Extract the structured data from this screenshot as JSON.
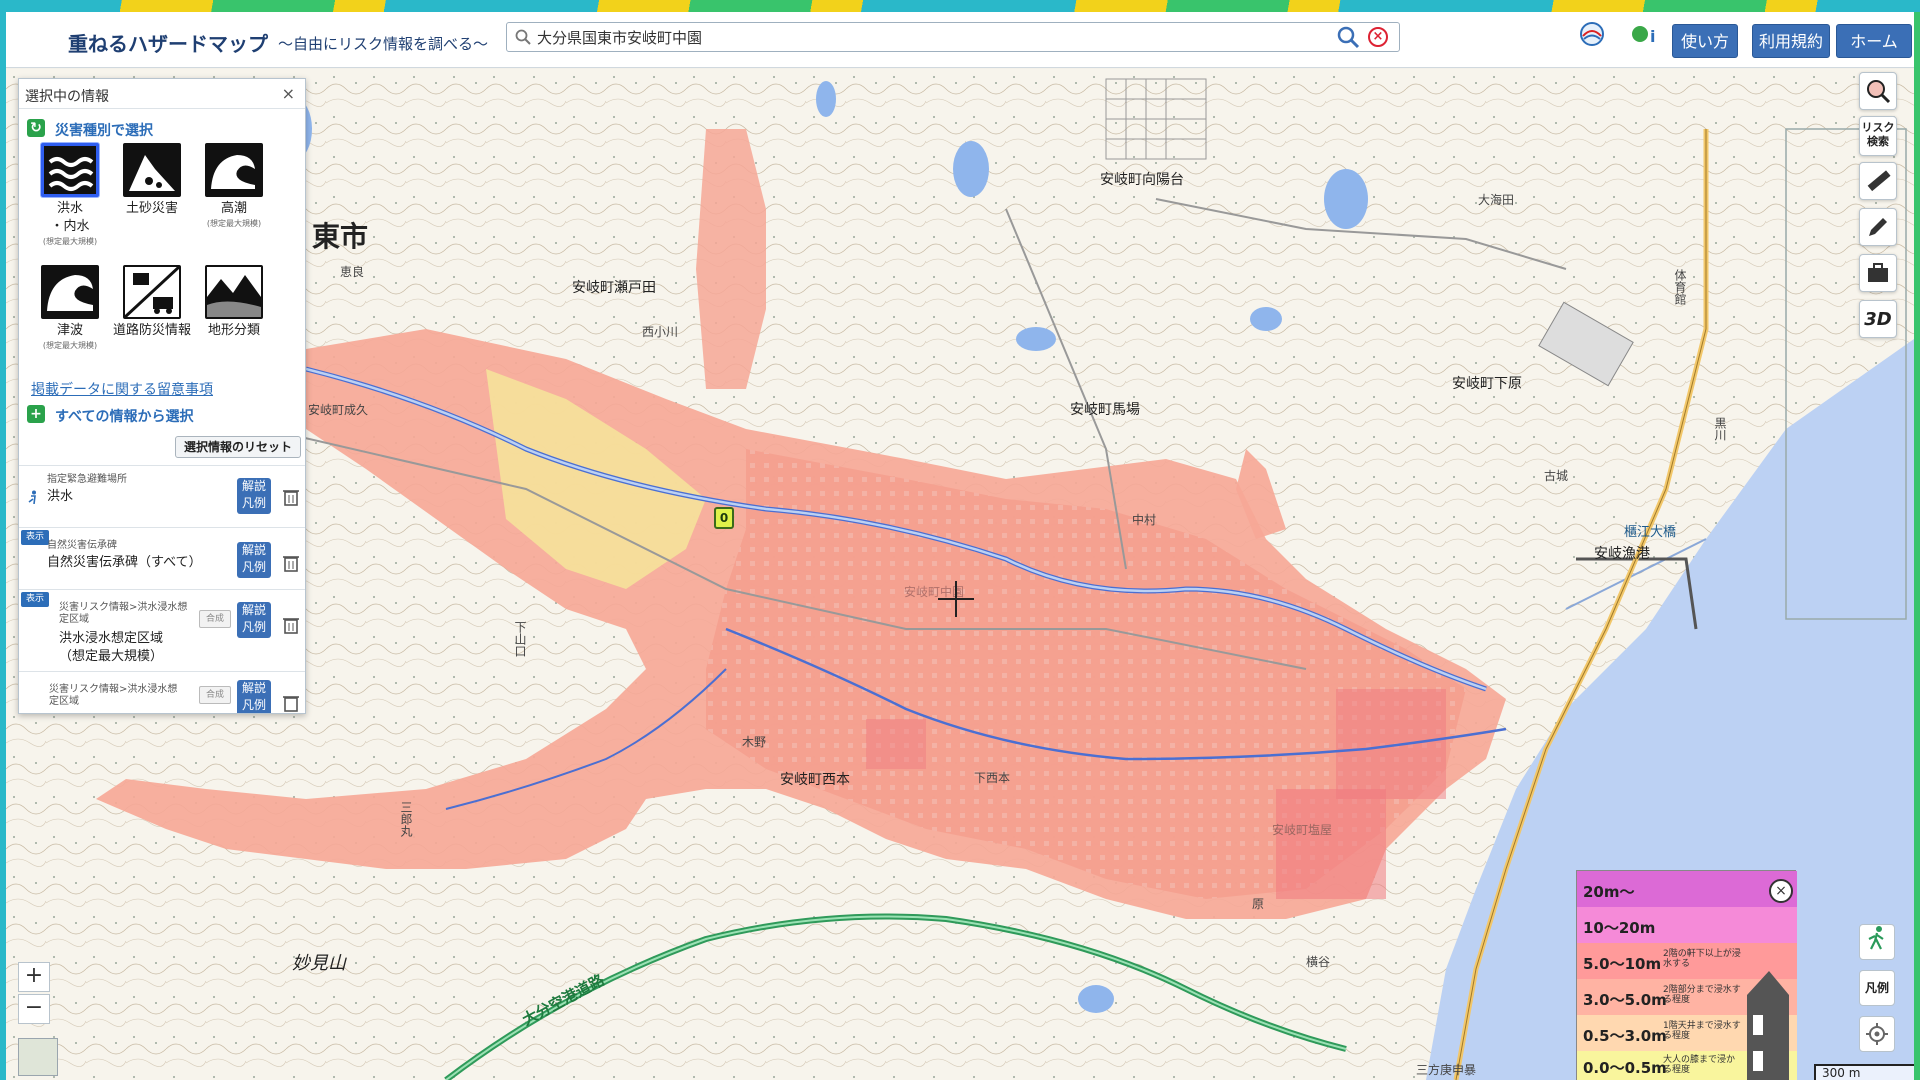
{
  "header": {
    "title": "重ねるハザードマップ",
    "subtitle": "〜自由にリスク情報を調べる〜",
    "search_value": "大分県国東市安岐町中園",
    "buttons": {
      "howto": "使い方",
      "terms": "利用規約",
      "home": "ホーム"
    },
    "logo1": "国土交通省",
    "logo2": "国土地理院"
  },
  "panel": {
    "title": "選択中の情報",
    "close": "×",
    "section1": "災害種別で選択",
    "hazards": [
      {
        "label": "洪水",
        "label2": "・内水",
        "note": "(想定最大規模)",
        "icon": "flood-icon",
        "selected": true
      },
      {
        "label": "土砂災害",
        "label2": "",
        "note": "",
        "icon": "landslide-icon",
        "selected": false
      },
      {
        "label": "高潮",
        "label2": "",
        "note": "(想定最大規模)",
        "icon": "storm-surge-icon",
        "selected": false
      },
      {
        "label": "津波",
        "label2": "",
        "note": "(想定最大規模)",
        "icon": "tsunami-icon",
        "selected": false
      },
      {
        "label": "道路防災情報",
        "label2": "",
        "note": "",
        "icon": "road-icon",
        "selected": false
      },
      {
        "label": "地形分類",
        "label2": "",
        "note": "",
        "icon": "terrain-icon",
        "selected": false
      }
    ],
    "notes_link": "掲載データに関する留意事項",
    "section2": "すべての情報から選択",
    "reset": "選択情報のリセット",
    "layers": [
      {
        "tag": "",
        "cat": "指定緊急避難場所",
        "name": "洪水",
        "legend": "解説\n凡例"
      },
      {
        "tag": "表示",
        "cat": "自然災害伝承碑",
        "name": "自然災害伝承碑（すべて）",
        "legend": "解説\n凡例"
      },
      {
        "tag": "表示",
        "cat": "災害リスク情報>洪水浸水想定区域",
        "name": "洪水浸水想定区域",
        "name2": "（想定最大規模）",
        "legend": "解説\n凡例",
        "merge": "合成"
      },
      {
        "tag": "",
        "cat": "災害リスク情報>洪水浸水想定区域",
        "name": "",
        "legend": "解説\n凡例",
        "merge": "合成"
      }
    ]
  },
  "map": {
    "places": [
      {
        "text": "東市",
        "cls": "big"
      },
      {
        "text": "安岐町向陽台",
        "cls": ""
      },
      {
        "text": "安岐町瀬戸田",
        "cls": ""
      },
      {
        "text": "西小川",
        "cls": "small"
      },
      {
        "text": "安岐町馬場",
        "cls": ""
      },
      {
        "text": "安岐町下原",
        "cls": ""
      },
      {
        "text": "大海田",
        "cls": "small"
      },
      {
        "text": "安岐町中園",
        "cls": "small"
      },
      {
        "text": "安岐町西本",
        "cls": ""
      },
      {
        "text": "下西本",
        "cls": "small"
      },
      {
        "text": "安岐町塩屋",
        "cls": "small"
      },
      {
        "text": "妙見山",
        "cls": "mountain"
      },
      {
        "text": "大分空港道路",
        "cls": "road"
      },
      {
        "text": "安岐漁港",
        "cls": ""
      },
      {
        "text": "櫃江大橋",
        "cls": "bridge"
      },
      {
        "text": "三方庚申暴",
        "cls": "small"
      },
      {
        "text": "中村",
        "cls": "small"
      },
      {
        "text": "古城",
        "cls": "small"
      },
      {
        "text": "木野",
        "cls": "small"
      },
      {
        "text": "下山口",
        "cls": "small"
      },
      {
        "text": "三郎丸",
        "cls": "small"
      },
      {
        "text": "横谷",
        "cls": "small"
      },
      {
        "text": "原",
        "cls": "small"
      },
      {
        "text": "恵良",
        "cls": "small"
      },
      {
        "text": "安岐町成久",
        "cls": "small"
      },
      {
        "text": "黒川",
        "cls": "small"
      },
      {
        "text": "体育館",
        "cls": "small"
      }
    ],
    "marker": "0",
    "scale": "300 m"
  },
  "toolbar": {
    "risk_search": "リスク検索",
    "three_d": "3D",
    "legend": "凡例"
  },
  "zoom": {
    "in": "+",
    "out": "−"
  },
  "legend": {
    "rows": [
      {
        "range": "20m〜",
        "desc": "",
        "color": "#dc6ad6"
      },
      {
        "range": "10〜20m",
        "desc": "",
        "color": "#f58ad8"
      },
      {
        "range": "5.0〜10m",
        "desc": "2階の軒下以上が浸水する",
        "color": "#ff9a9a"
      },
      {
        "range": "3.0〜5.0m",
        "desc": "2階部分まで浸水する程度",
        "color": "#ffb3a3"
      },
      {
        "range": "0.5〜3.0m",
        "desc": "1階天井まで浸水する程度",
        "color": "#ffd8b0"
      },
      {
        "range": "0.0〜0.5m",
        "desc": "大人の膝まで浸かる程度",
        "color": "#f9f59d"
      }
    ],
    "close": "×"
  }
}
